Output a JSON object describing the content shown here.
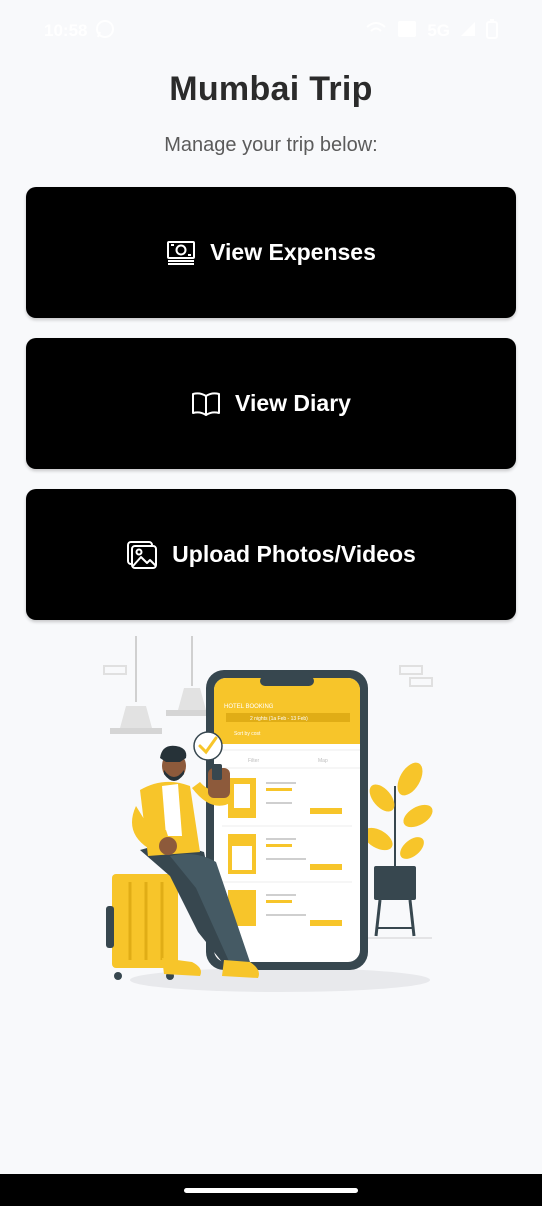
{
  "status_bar": {
    "time": "10:58",
    "network": "5G"
  },
  "header": {
    "title": "Mumbai Trip",
    "subtitle": "Manage your trip below:"
  },
  "actions": [
    {
      "label": "View Expenses",
      "icon": "money-icon"
    },
    {
      "label": "View Diary",
      "icon": "book-icon"
    },
    {
      "label": "Upload Photos/Videos",
      "icon": "image-icon"
    }
  ],
  "illustration": {
    "phone_header": "HOTEL BOOKING",
    "dates_bar": "2 nights (1a Feb - 13 Feb)",
    "search_row": "Sort by cost",
    "filter_label": "Filter",
    "map_label": "Map"
  },
  "colors": {
    "accent": "#f7c52a",
    "button_bg": "#000000",
    "page_bg": "#f8f9fb",
    "title_text": "#2b2b2b"
  }
}
